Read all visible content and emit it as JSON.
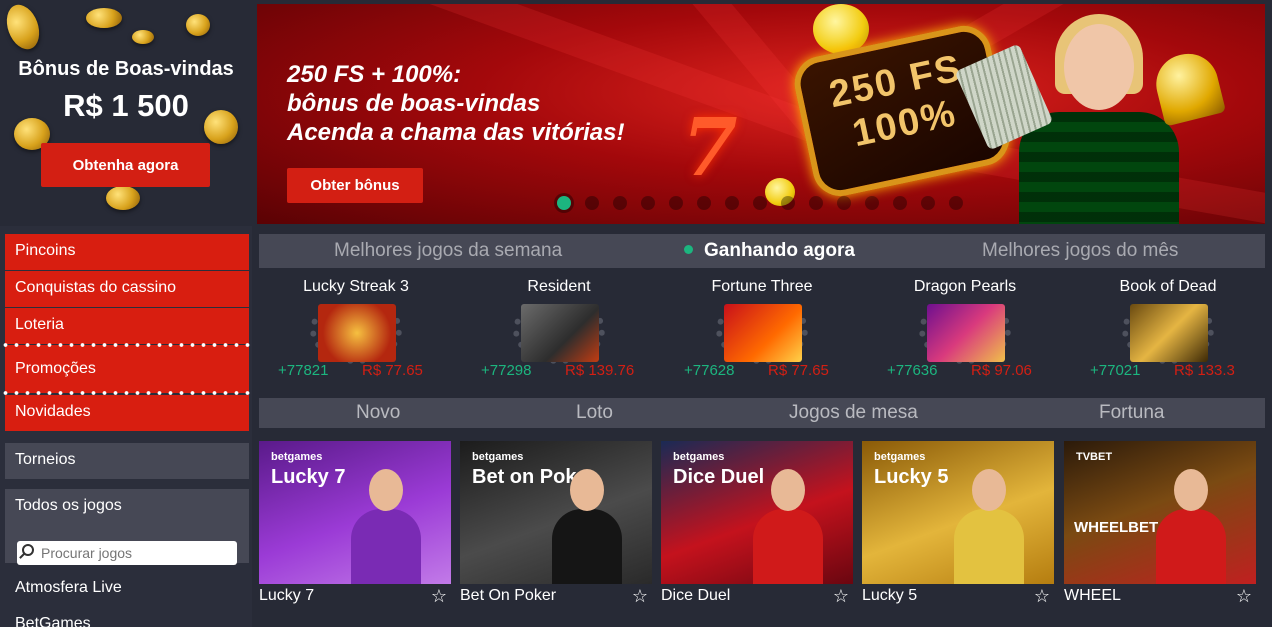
{
  "sidebar": {
    "bonus_title": "Bônus de Boas-vindas",
    "bonus_amount": "R$ 1 500",
    "bonus_button": "Obtenha agora",
    "menu": [
      "Pincoins",
      "Conquistas do cassino",
      "Loteria",
      "Promoções",
      "Novidades"
    ],
    "tournaments": "Torneios",
    "all_games": "Todos os jogos",
    "search_placeholder": "Procurar jogos",
    "links": [
      "Atmosfera Live",
      "BetGames"
    ]
  },
  "banner": {
    "line1": "250 FS + 100%:",
    "line2": "bônus de boas-vindas",
    "line3": "Acenda a chama das vitórias!",
    "button": "Obter bônus",
    "sign_line1": "250 FS",
    "sign_line2": "100%",
    "slide_count": 15,
    "active_slide": 1
  },
  "tabs": [
    "Melhores jogos da semana",
    "Ganhando agora",
    "Melhores jogos do mês"
  ],
  "active_tab": "Ganhando agora",
  "winners": [
    {
      "name": "Lucky Streak 3",
      "count": "+77821",
      "amount": "R$ 77.65"
    },
    {
      "name": "Resident",
      "count": "+77298",
      "amount": "R$ 139.76"
    },
    {
      "name": "Fortune Three",
      "count": "+77628",
      "amount": "R$ 77.65"
    },
    {
      "name": "Dragon Pearls",
      "count": "+77636",
      "amount": "R$ 97.06"
    },
    {
      "name": "Book of Dead",
      "count": "+77021",
      "amount": "R$ 133.3"
    }
  ],
  "categories": [
    "Novo",
    "Loto",
    "Jogos de mesa",
    "Fortuna"
  ],
  "games": [
    {
      "brand": "betgames",
      "title": "Lucky 7",
      "name": "Lucky 7"
    },
    {
      "brand": "betgames",
      "title": "Bet on Poker",
      "name": "Bet On Poker"
    },
    {
      "brand": "betgames",
      "title": "Dice Duel",
      "name": "Dice Duel"
    },
    {
      "brand": "betgames",
      "title": "Lucky 5",
      "name": "Lucky 5"
    },
    {
      "brand": "TVBET",
      "title": "WHEELBET",
      "name": "WHEEL"
    }
  ],
  "colors": {
    "accent_red": "#d81e10",
    "win_green": "#1cb57f",
    "panel_gray": "#464855",
    "background": "#272a36"
  }
}
